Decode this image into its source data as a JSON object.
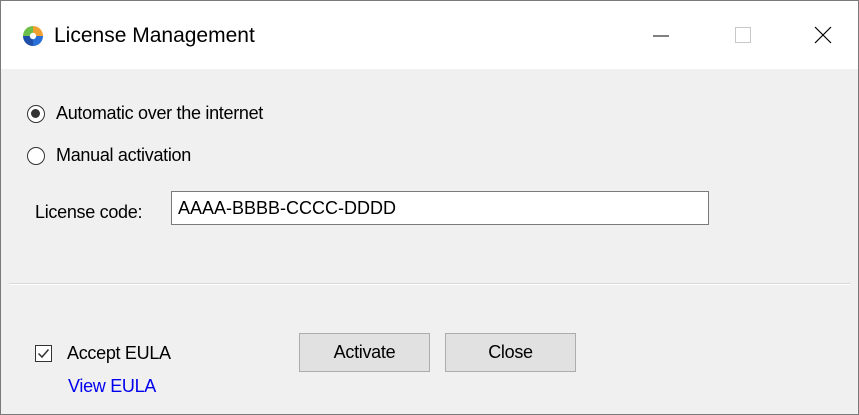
{
  "window": {
    "title": "License Management",
    "controls": {
      "minimize": "minimize-icon",
      "maximize": "maximize-icon",
      "close": "close-icon"
    }
  },
  "activation": {
    "options": [
      {
        "label": "Automatic over the internet",
        "selected": true
      },
      {
        "label": "Manual activation",
        "selected": false
      }
    ],
    "license_label": "License code:",
    "license_value": "AAAA-BBBB-CCCC-DDDD"
  },
  "footer": {
    "accept_label": "Accept EULA",
    "accept_checked": true,
    "view_eula_label": "View EULA",
    "activate_label": "Activate",
    "close_label": "Close"
  },
  "colors": {
    "link": "#0000ee",
    "button_bg": "#e1e1e1",
    "client_bg": "#f0f0f0"
  }
}
